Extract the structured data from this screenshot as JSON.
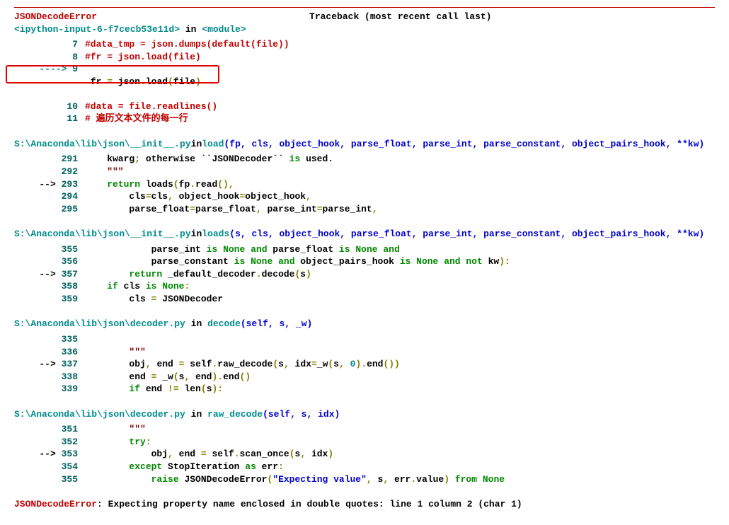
{
  "header": {
    "error_name": "JSONDecodeError",
    "traceback_label": "Traceback (most recent call last)"
  },
  "input_loc": {
    "prefix": "<ipython-input-6-f7cecb53e11d>",
    "in": " in ",
    "module": "<module>"
  },
  "frame1": {
    "l7_num": "7",
    "l7_code": "#data_tmp = json.dumps(default(file))",
    "l8_num": "8",
    "l8_code": "#fr = json.load(file)",
    "l9_arrow": "----> ",
    "l9_num": "9",
    "l9_fr": " fr ",
    "l9_eq": "=",
    "l9_json": " json",
    "l9_load": "load",
    "l9_file": "file",
    "l10_num": "10",
    "l10_code": "#data = file.readlines()",
    "l11_num": "11",
    "l11_code": "# 遍历文本文件的每一行"
  },
  "frame2": {
    "loc_path": "S:\\Anaconda\\lib\\json\\__init__.py",
    "loc_in": " in ",
    "loc_func": "load",
    "loc_args": "(fp, cls, object_hook, parse_float, parse_int, parse_constant, object_pairs_hook, **kw)",
    "l291_num": "291",
    "l291_a": "    kwarg",
    "l291_b": ";",
    "l291_c": " otherwise ``JSONDecoder`` ",
    "l291_d": "is",
    "l291_e": " used.",
    "l292_num": "292",
    "l292_code": "    \"\"\"",
    "l293_arrow": "--> ",
    "l293_num": "293",
    "l293_a": "    ",
    "l293_ret": "return",
    "l293_b": " loads",
    "l293_c": "(",
    "l293_d": "fp",
    "l293_e": ".",
    "l293_f": "read",
    "l293_g": "(),",
    "l294_num": "294",
    "l294_a": "        cls",
    "l294_b": "=",
    "l294_c": "cls",
    "l294_d": ",",
    "l294_e": " object_hook",
    "l294_f": "=",
    "l294_g": "object_hook",
    "l294_h": ",",
    "l295_num": "295",
    "l295_a": "        parse_float",
    "l295_b": "=",
    "l295_c": "parse_float",
    "l295_d": ",",
    "l295_e": " parse_int",
    "l295_f": "=",
    "l295_g": "parse_int",
    "l295_h": ","
  },
  "frame3": {
    "loc_path": "S:\\Anaconda\\lib\\json\\__init__.py",
    "loc_in": " in ",
    "loc_func": "loads",
    "loc_args": "(s, cls, object_hook, parse_float, parse_int, parse_constant, object_pairs_hook, **kw)",
    "l355_num": "355",
    "l355_a": "            parse_int ",
    "l355_b": "is",
    "l355_c": " ",
    "l355_d": "None",
    "l355_e": " ",
    "l355_f": "and",
    "l355_g": " parse_float ",
    "l355_h": "is",
    "l355_i": " ",
    "l355_j": "None",
    "l355_k": " ",
    "l355_l": "and",
    "l356_num": "356",
    "l356_a": "            parse_constant ",
    "l356_b": "is",
    "l356_c": " ",
    "l356_d": "None",
    "l356_e": " ",
    "l356_f": "and",
    "l356_g": " object_pairs_hook ",
    "l356_h": "is",
    "l356_i": " ",
    "l356_j": "None",
    "l356_k": " ",
    "l356_l": "and",
    "l356_m": " ",
    "l356_n": "not",
    "l356_o": " kw",
    "l356_p": "):",
    "l357_arrow": "--> ",
    "l357_num": "357",
    "l357_a": "        ",
    "l357_ret": "return",
    "l357_b": " _default_decoder",
    "l357_c": ".",
    "l357_d": "decode",
    "l357_e": "(",
    "l357_f": "s",
    "l357_g": ")",
    "l358_num": "358",
    "l358_a": "    ",
    "l358_b": "if",
    "l358_c": " cls ",
    "l358_d": "is",
    "l358_e": " ",
    "l358_f": "None",
    "l358_g": ":",
    "l359_num": "359",
    "l359_a": "        cls ",
    "l359_b": "=",
    "l359_c": " JSONDecoder"
  },
  "frame4": {
    "loc_path": "S:\\Anaconda\\lib\\json\\decoder.py",
    "loc_in": " in ",
    "loc_func": "decode",
    "loc_args": "(self, s, _w)",
    "l335_num": "335",
    "l335_code": "",
    "l336_num": "336",
    "l336_code": "        \"\"\"",
    "l337_arrow": "--> ",
    "l337_num": "337",
    "l337_a": "        obj",
    "l337_b": ",",
    "l337_c": " end ",
    "l337_d": "=",
    "l337_e": " self",
    "l337_f": ".",
    "l337_g": "raw_decode",
    "l337_h": "(",
    "l337_i": "s",
    "l337_j": ",",
    "l337_k": " idx",
    "l337_l": "=",
    "l337_m": "_w",
    "l337_n": "(",
    "l337_o": "s",
    "l337_p": ",",
    "l337_q": " ",
    "l337_r": "0",
    "l337_s": ").",
    "l337_t": "end",
    "l337_u": "())",
    "l338_num": "338",
    "l338_a": "        end ",
    "l338_b": "=",
    "l338_c": " _w",
    "l338_d": "(",
    "l338_e": "s",
    "l338_f": ",",
    "l338_g": " end",
    "l338_h": ").",
    "l338_i": "end",
    "l338_j": "()",
    "l339_num": "339",
    "l339_a": "        ",
    "l339_b": "if",
    "l339_c": " end ",
    "l339_d": "!=",
    "l339_e": " len",
    "l339_f": "(",
    "l339_g": "s",
    "l339_h": "):"
  },
  "frame5": {
    "loc_path": "S:\\Anaconda\\lib\\json\\decoder.py",
    "loc_in": " in ",
    "loc_func": "raw_decode",
    "loc_args": "(self, s, idx)",
    "l351_num": "351",
    "l351_code": "        \"\"\"",
    "l352_num": "352",
    "l352_a": "        ",
    "l352_b": "try",
    "l352_c": ":",
    "l353_arrow": "--> ",
    "l353_num": "353",
    "l353_a": "            obj",
    "l353_b": ",",
    "l353_c": " end ",
    "l353_d": "=",
    "l353_e": " self",
    "l353_f": ".",
    "l353_g": "scan_once",
    "l353_h": "(",
    "l353_i": "s",
    "l353_j": ",",
    "l353_k": " idx",
    "l353_l": ")",
    "l354_num": "354",
    "l354_a": "        ",
    "l354_b": "except",
    "l354_c": " StopIteration ",
    "l354_d": "as",
    "l354_e": " err",
    "l354_f": ":",
    "l355_num": "355",
    "l355_a": "            ",
    "l355_b": "raise",
    "l355_c": " JSONDecodeError",
    "l355_d": "(",
    "l355_e": "\"Expecting value\"",
    "l355_f": ",",
    "l355_g": " s",
    "l355_h": ",",
    "l355_i": " err",
    "l355_j": ".",
    "l355_k": "value",
    "l355_l": ")",
    "l355_m": " ",
    "l355_n": "from",
    "l355_o": " ",
    "l355_p": "None"
  },
  "final": {
    "name": "JSONDecodeError",
    "msg": ": Expecting property name enclosed in double quotes: line 1 column 2 (char 1)"
  }
}
